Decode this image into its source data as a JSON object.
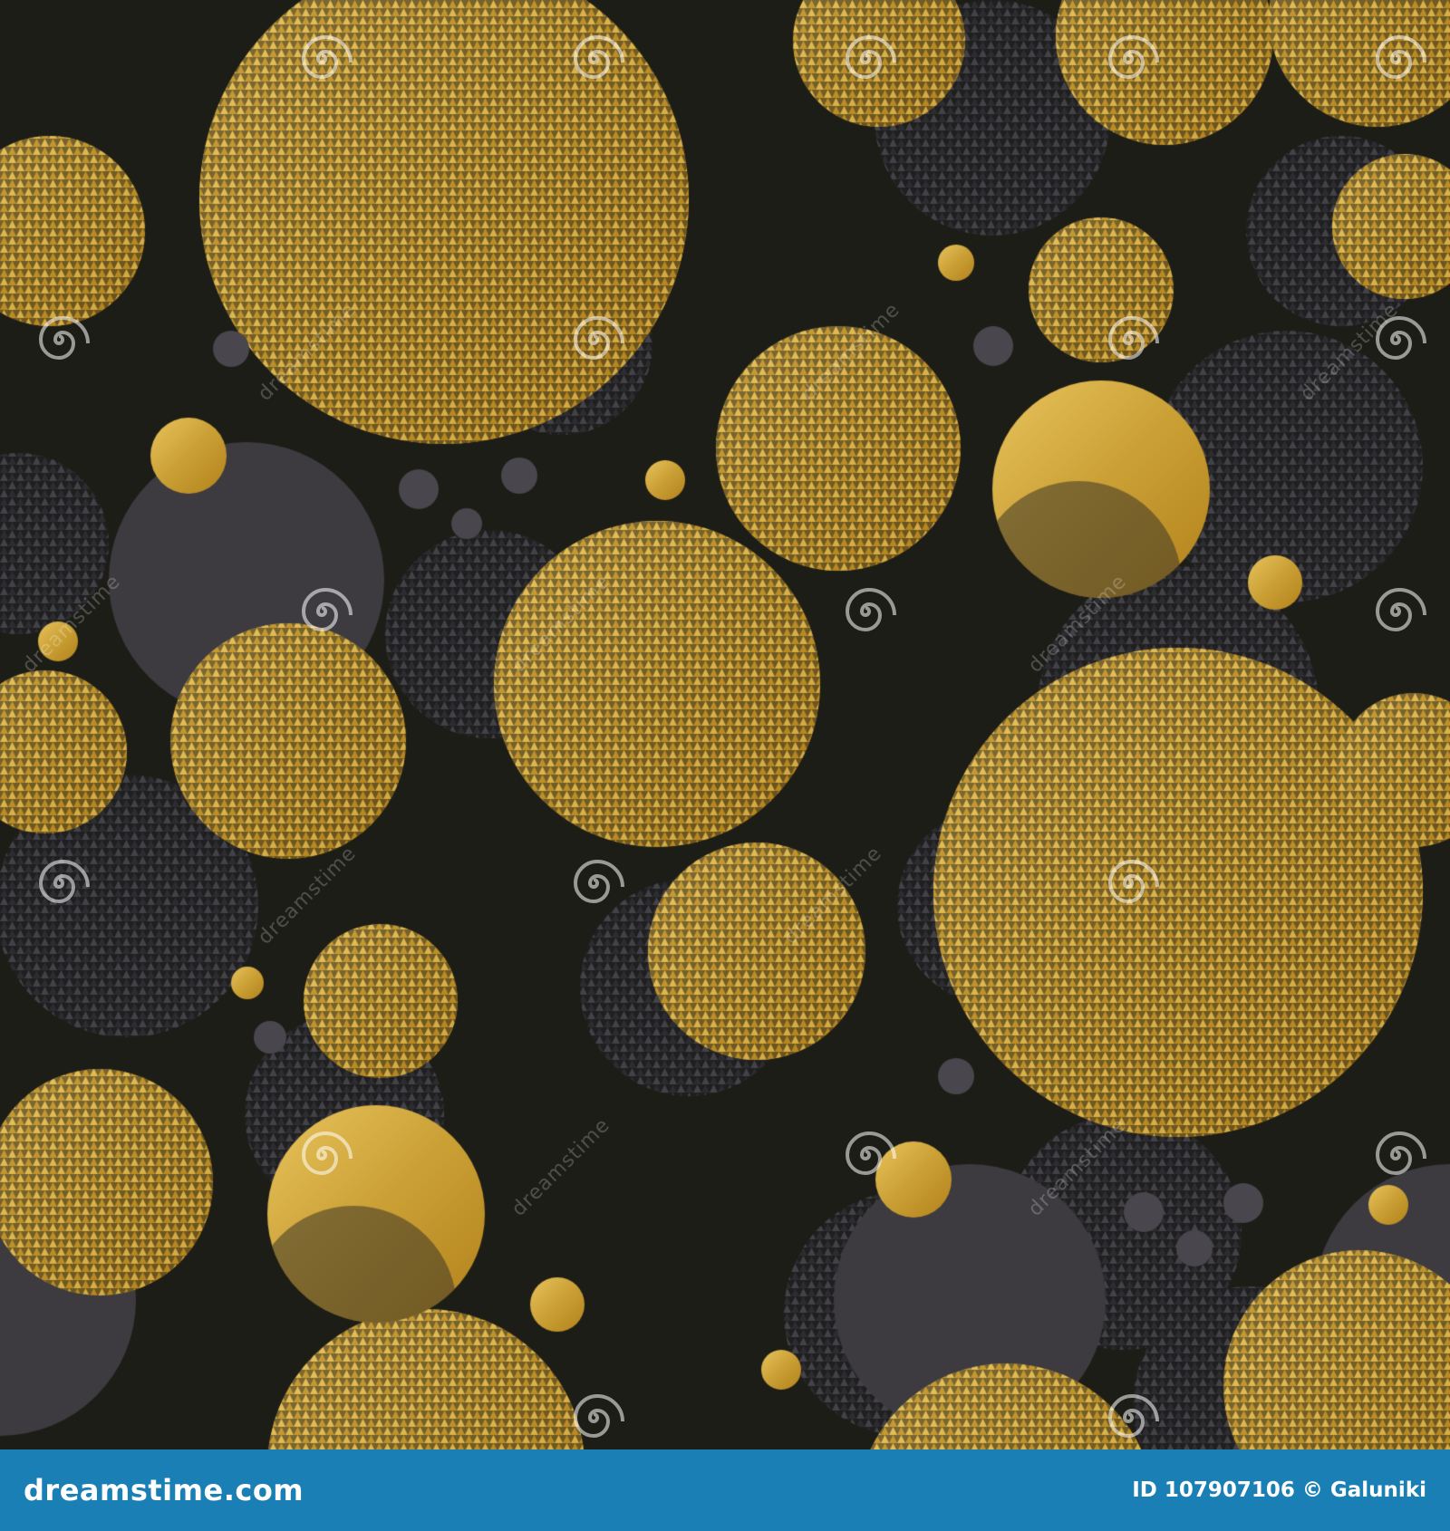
{
  "pattern": {
    "background": "#1d1d17",
    "gold": [
      "#b3821c",
      "#e8c35d",
      "#caa035"
    ],
    "slate": [
      "#3d3b40",
      "#49474d",
      "#5a5860"
    ]
  },
  "watermark": {
    "text": "dreamstime",
    "icon_name": "spiral-icon"
  },
  "footer": {
    "site": "dreamstime.com",
    "id_text": "ID 107907106",
    "author": "© Galuniki"
  }
}
